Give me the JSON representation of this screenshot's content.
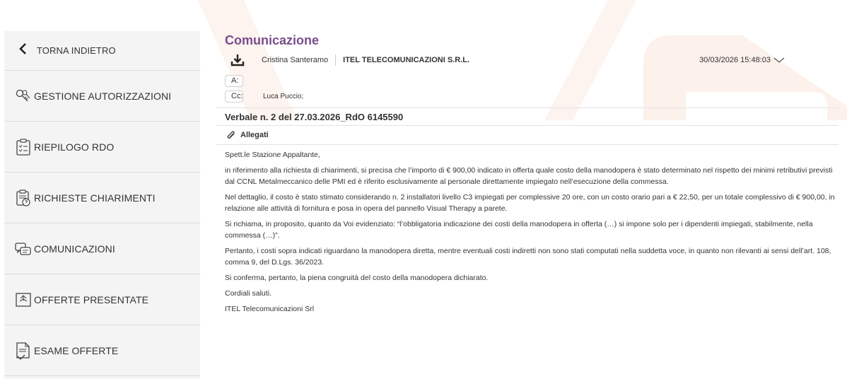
{
  "sidebar": {
    "back_label": "TORNA INDIETRO",
    "items": [
      {
        "label": "GESTIONE AUTORIZZAZIONI",
        "icon": "keys-icon"
      },
      {
        "label": "RIEPILOGO RDO",
        "icon": "clipboard-list-icon"
      },
      {
        "label": "RICHIESTE CHIARIMENTI",
        "icon": "clipboard-question-icon"
      },
      {
        "label": "COMUNICAZIONI",
        "icon": "chat-bubbles-icon"
      },
      {
        "label": "OFFERTE PRESENTATE",
        "icon": "offer-card-icon"
      },
      {
        "label": "ESAME OFFERTE",
        "icon": "document-check-icon"
      }
    ]
  },
  "message": {
    "title": "Comunicazione",
    "sender": "Cristina Santeramo",
    "company": "ITEL TELECOMUNICAZIONI S.R.L.",
    "date": "30/03/2026 15:48:03",
    "to_label": "A:",
    "to_value": "",
    "cc_label": "Cc:",
    "cc_value": "Luca Puccio;",
    "subject": "Verbale n. 2 del 27.03.2026_RdO 6145590",
    "attachments_label": "Allegati",
    "paragraphs": [
      "Spett.le Stazione Appaltante,",
      "in riferimento alla richiesta di chiarimenti, si precisa che l’importo di € 900,00 indicato in offerta quale costo della manodopera è stato determinato nel rispetto dei minimi retributivi previsti dal CCNL Metalmeccanico delle PMI ed è riferito esclusivamente al personale direttamente impiegato nell’esecuzione della commessa.",
      "Nel dettaglio, il costo è stato stimato considerando n. 2 installatori livello C3 impiegati per complessive 20 ore, con un costo orario pari a € 22,50, per un totale complessivo di € 900,00, in relazione alle attività di fornitura e posa in opera del pannello Visual Therapy a parete.",
      "Si richiama, in proposito, quanto da Voi evidenziato: “l’obbligatoria indicazione dei costi della manodopera in offerta (…) si impone solo per i dipendenti impiegati, stabilmente, nella commessa (…)”.",
      "Pertanto, i costi sopra indicati riguardano la manodopera diretta, mentre eventuali costi indiretti non sono stati computati nella suddetta voce, in quanto non rilevanti ai sensi dell’art. 108, comma 9, del D.Lgs. 36/2023.",
      "Si conferma, pertanto, la piena congruità del costo della manodopera dichiarato.",
      "Cordiali saluti.",
      "ITEL Telecomunicazioni Srl"
    ]
  },
  "colors": {
    "title": "#7a4d8c",
    "sidebar_bg": "#f4f4f4",
    "deco": "#fdf1ec"
  }
}
